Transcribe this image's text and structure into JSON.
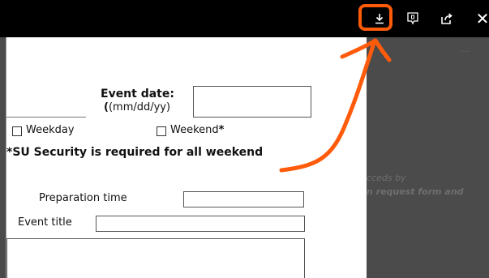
{
  "toolbar": {
    "download_icon": "download-icon",
    "comment_icon": "comment-icon",
    "share_icon": "share-icon",
    "close_label": "✕"
  },
  "form": {
    "event_date_label": "Event date:",
    "event_date_format": "(mm/dd/yy)",
    "weekday_label": "Weekday",
    "weekend_label": "Weekend",
    "weekend_asterisk": "*",
    "security_note": "*SU Security is required for all weekend",
    "preparation_time_label": "Preparation time",
    "event_title_label": "Event title"
  },
  "side_panel": {
    "dots": "...",
    "text_line1": "cceds by",
    "text_line2": "n request form and"
  },
  "annotation": {
    "color": "#ff5b0a"
  }
}
